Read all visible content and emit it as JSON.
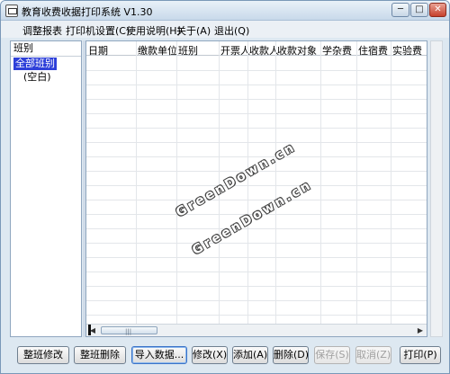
{
  "window": {
    "title": "教育收费收据打印系统 V1.30",
    "controls": [
      "─",
      "□",
      "✕"
    ]
  },
  "menu": [
    {
      "label": "调整报表"
    },
    {
      "label": "打印机设置(C)"
    },
    {
      "label": "使用说明(H)"
    },
    {
      "label": "关于(A)"
    },
    {
      "label": "退出(Q)"
    }
  ],
  "left_panel": {
    "header": "班别",
    "items": [
      {
        "label": "全部班别",
        "selected": true
      },
      {
        "label": "(空白)",
        "selected": false
      }
    ]
  },
  "grid": {
    "columns": [
      "日期",
      "缴款单位",
      "班别",
      "开票人",
      "收款人",
      "收款对象",
      "学杂费",
      "住宿费",
      "实验费"
    ],
    "rows": []
  },
  "watermarks": [
    "GreenDown.cn",
    "GreenDown.cn"
  ],
  "scroll_grip": "|||",
  "buttons": [
    {
      "label": "整班修改",
      "enabled": true
    },
    {
      "label": "整班删除",
      "enabled": true
    },
    {
      "label": "导入数据...",
      "enabled": true,
      "focused": true
    },
    {
      "label": "修改(X)",
      "enabled": true
    },
    {
      "label": "添加(A)",
      "enabled": true
    },
    {
      "label": "删除(D)",
      "enabled": true
    },
    {
      "label": "保存(S)",
      "enabled": false
    },
    {
      "label": "取消(Z)",
      "enabled": false
    },
    {
      "label": "打印(P)",
      "enabled": true
    }
  ]
}
